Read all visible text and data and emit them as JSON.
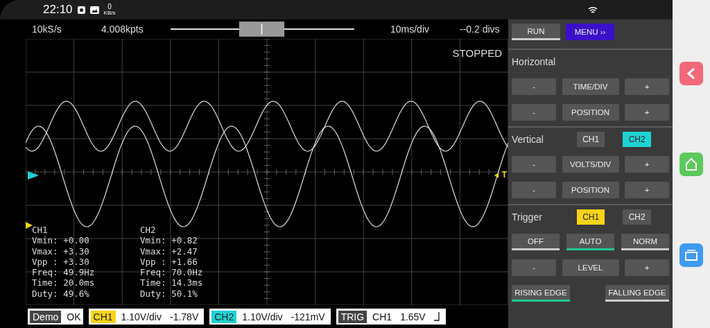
{
  "status_bar": {
    "time": "22:10",
    "net_speed": "0",
    "net_unit": "KB/s"
  },
  "toolbar": {
    "sample_rate": "10kS/s",
    "points": "4.008kpts",
    "time_div": "10ms/div",
    "offset": "--0.2 divs"
  },
  "plot": {
    "state": "STOPPED",
    "trigger_marker": "T",
    "measurements": [
      {
        "name": "CH1",
        "lines": [
          "Vmin: +0.00",
          "Vmax: +3.30",
          "Vpp : +3.30",
          "Freq: 49.9Hz",
          "Time: 20.0ms",
          "Duty: 49.6%"
        ]
      },
      {
        "name": "CH2",
        "lines": [
          "Vmin: +0.82",
          "Vmax: +2.47",
          "Vpp : +1.66",
          "Freq: 70.0Hz",
          "Time: 14.3ms",
          "Duty: 50.1%"
        ]
      }
    ]
  },
  "bottom_bar": {
    "mode": {
      "label": "Demo",
      "value": "OK"
    },
    "channels": [
      {
        "name": "CH1",
        "color": "#f7d417",
        "scale": "1.10V/div",
        "offset": "-1.78V"
      },
      {
        "name": "CH2",
        "color": "#1ed2d2",
        "scale": "1.10V/div",
        "offset": "-121mV"
      }
    ],
    "trigger": {
      "label": "TRIG",
      "source": "CH1",
      "level": "1.65V"
    }
  },
  "panel": {
    "run": {
      "label": "RUN",
      "selected": false
    },
    "menu": {
      "label": "MENU ››"
    },
    "sections": [
      {
        "title": "Horizontal",
        "rows": [
          {
            "kind": "adjust",
            "items": [
              "-",
              "TIME/DIV",
              "+"
            ]
          },
          {
            "kind": "adjust",
            "items": [
              "-",
              "POSITION",
              "+"
            ]
          }
        ]
      },
      {
        "title": "Vertical",
        "selectors": [
          {
            "label": "CH1",
            "selected": false
          },
          {
            "label": "CH2",
            "selected": true
          }
        ],
        "rows": [
          {
            "kind": "adjust",
            "items": [
              "-",
              "VOLTS/DIV",
              "+"
            ]
          },
          {
            "kind": "adjust",
            "items": [
              "-",
              "POSITION",
              "+"
            ]
          }
        ]
      },
      {
        "title": "Trigger",
        "selectors": [
          {
            "label": "CH1",
            "selected": true
          },
          {
            "label": "CH2",
            "selected": false
          }
        ],
        "rows": [
          {
            "kind": "modes",
            "items": [
              {
                "label": "OFF",
                "selected": false
              },
              {
                "label": "AUTO",
                "selected": true
              },
              {
                "label": "NORM",
                "selected": false
              }
            ]
          },
          {
            "kind": "adjust",
            "items": [
              "-",
              "LEVEL",
              "+"
            ]
          },
          {
            "kind": "edges",
            "items": [
              {
                "label": "RISING EDGE",
                "selected": true
              },
              {
                "label": "FALLING EDGE",
                "selected": false
              }
            ]
          }
        ]
      }
    ]
  }
}
